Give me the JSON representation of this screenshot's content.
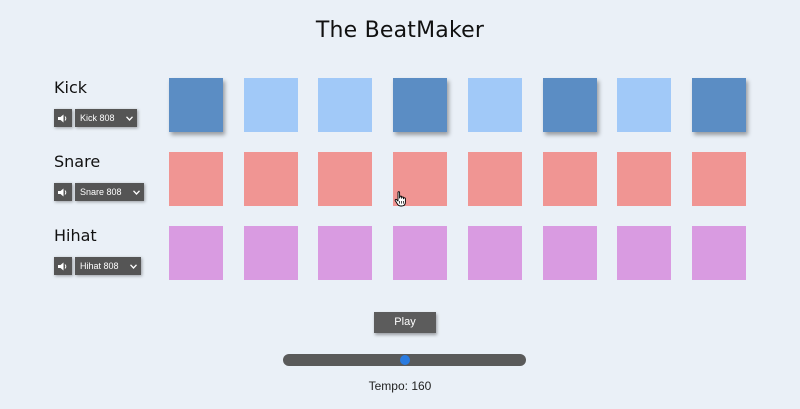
{
  "title": "The BeatMaker",
  "tracks": [
    {
      "name": "Kick",
      "sound": "Kick 808",
      "mute_icon": "speaker-icon",
      "pads_active": [
        true,
        false,
        false,
        true,
        false,
        true,
        false,
        true
      ]
    },
    {
      "name": "Snare",
      "sound": "Snare 808",
      "mute_icon": "speaker-icon",
      "pads_active": [
        false,
        false,
        false,
        false,
        false,
        false,
        false,
        false
      ]
    },
    {
      "name": "Hihat",
      "sound": "Hihat 808",
      "mute_icon": "speaker-icon",
      "pads_active": [
        false,
        false,
        false,
        false,
        false,
        false,
        false,
        false
      ]
    }
  ],
  "controls": {
    "play_label": "Play",
    "tempo_label": "Tempo:",
    "tempo_value": "160",
    "tempo_slider_fraction": 0.5
  },
  "colors": {
    "background": "#eaf0f7",
    "kick_inactive": "#a1c9f8",
    "kick_active": "#5b8dc4",
    "snare": "#f09593",
    "hihat": "#d99be1",
    "slider_thumb": "#2a7be0"
  }
}
